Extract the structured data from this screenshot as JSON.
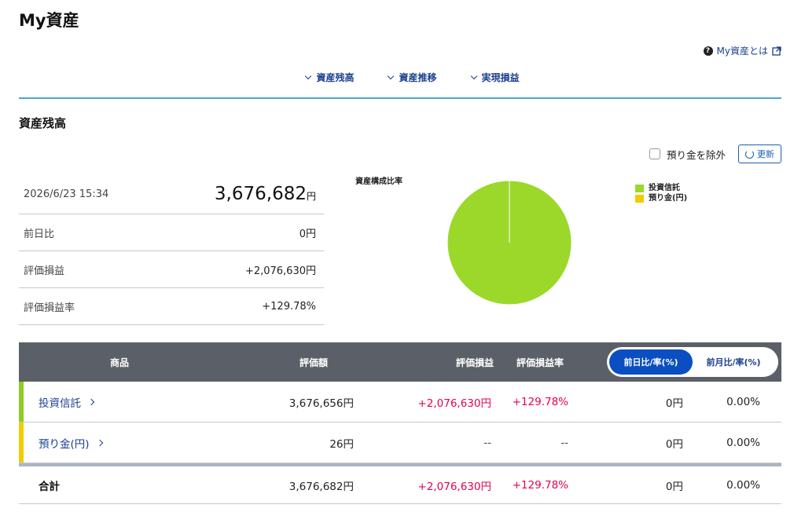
{
  "page": {
    "title": "My資産"
  },
  "help": {
    "label": "My資産とは",
    "icon": "question-circle-icon",
    "ext_icon": "external-link-icon"
  },
  "nav": {
    "items": [
      {
        "label": "資産残高"
      },
      {
        "label": "資産推移"
      },
      {
        "label": "実現損益"
      }
    ]
  },
  "section": {
    "title": "資産残高",
    "exclude_deposit_label": "預り金を除外",
    "refresh_label": "更新"
  },
  "summary": {
    "datetime": "2026/6/23 15:34",
    "total": "3,676,682",
    "total_unit": "円",
    "rows": [
      {
        "label": "前日比",
        "value": "0円"
      },
      {
        "label": "評価損益",
        "value": "+2,076,630円"
      },
      {
        "label": "評価損益率",
        "value": "+129.78%"
      }
    ]
  },
  "chart_data": {
    "type": "pie",
    "title": "資産構成比率",
    "legend_position": "right",
    "slices": [
      {
        "label": "投資信託",
        "value": 3676656,
        "color": "#9bd82a"
      },
      {
        "label": "預り金(円)",
        "value": 26,
        "color": "#f2cc00"
      }
    ]
  },
  "table": {
    "headers": {
      "product": "商品",
      "valuation": "評価額",
      "gain": "評価損益",
      "gain_rate": "評価損益率",
      "toggle_day": "前日比/率(%)",
      "toggle_month": "前月比/率(%)"
    },
    "rows": [
      {
        "product": "投資信託",
        "valuation": "3,676,656円",
        "gain": "+2,076,630円",
        "gain_rate": "+129.78%",
        "diff": "0円",
        "diff_rate": "0.00%",
        "bar_color": "#8ccc24"
      },
      {
        "product": "預り金(円)",
        "valuation": "26円",
        "gain": "--",
        "gain_rate": "--",
        "diff": "0円",
        "diff_rate": "0.00%",
        "bar_color": "#f2cc00"
      }
    ],
    "total": {
      "product": "合計",
      "valuation": "3,676,682円",
      "gain": "+2,076,630円",
      "gain_rate": "+129.78%",
      "diff": "0円",
      "diff_rate": "0.00%"
    }
  },
  "colors": {
    "accent": "#1a3f8f",
    "positive": "#e6004c",
    "header_bg": "#5b6068",
    "divider": "#4aa3e0"
  }
}
